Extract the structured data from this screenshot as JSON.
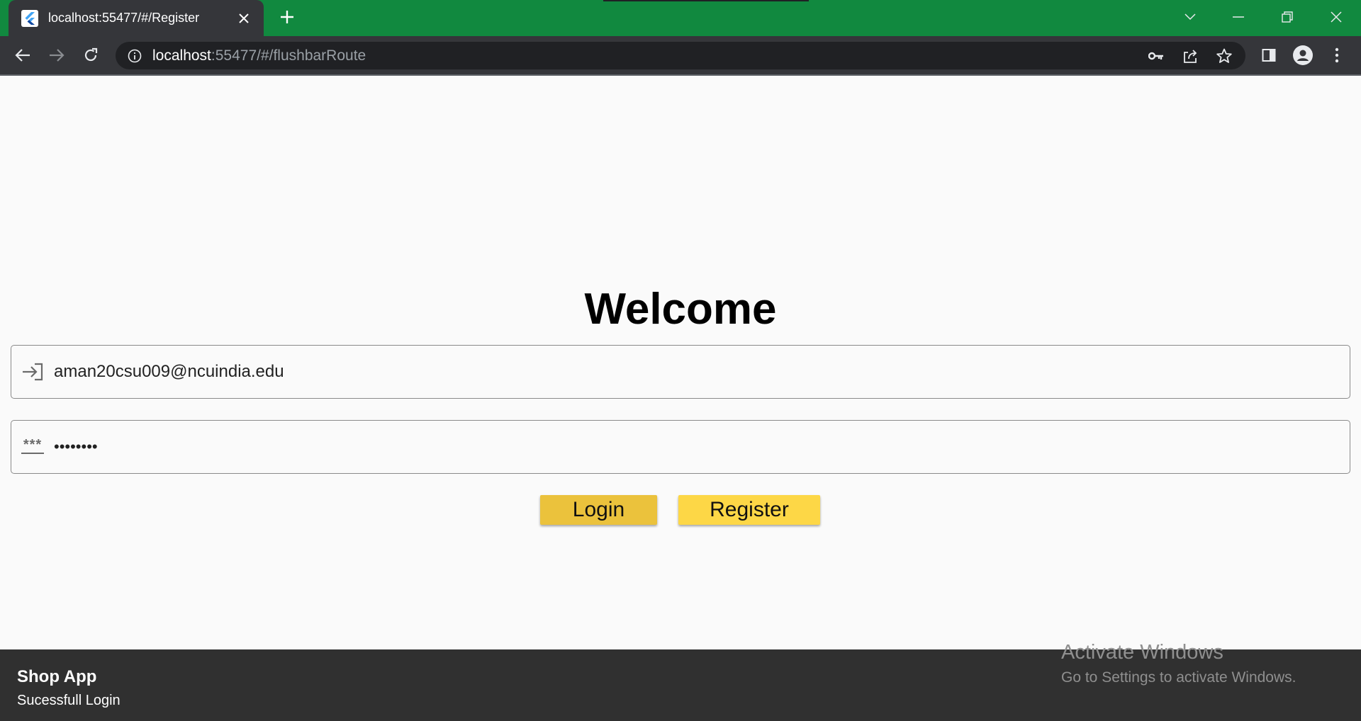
{
  "browser": {
    "tab": {
      "title": "localhost:55477/#/Register"
    },
    "omnibox": {
      "host": "localhost",
      "path": ":55477/#/flushbarRoute"
    }
  },
  "page": {
    "heading": "Welcome",
    "email_field": {
      "value": "aman20csu009@ncuindia.edu"
    },
    "password_field": {
      "value": "••••••••",
      "icon_glyph": "***"
    },
    "buttons": {
      "login": "Login",
      "register": "Register"
    }
  },
  "snackbar": {
    "title": "Shop App",
    "message": "Sucessfull Login"
  },
  "watermark": {
    "title": "Activate Windows",
    "subtitle": "Go to Settings to activate Windows."
  },
  "colors": {
    "tabstrip": "#11893f",
    "toolbar": "#35363a",
    "omnibox": "#202124",
    "login_button": "#ebc23c",
    "register_button": "#fdd746",
    "snackbar": "#303030"
  },
  "icons": {
    "tab_favicon": "flutter-logo-icon",
    "tab_close": "close-icon",
    "new_tab": "plus-icon",
    "window": [
      "chevron-down-icon",
      "minimize-icon",
      "restore-icon",
      "close-icon"
    ],
    "nav": [
      "back-arrow-icon",
      "forward-arrow-icon",
      "reload-icon"
    ],
    "omnibox": [
      "info-icon",
      "key-icon",
      "share-icon",
      "star-icon"
    ],
    "toolbar_right": [
      "side-panel-icon",
      "profile-icon",
      "kebab-menu-icon"
    ],
    "email_prefix": "login-icon",
    "password_prefix": "password-icon"
  }
}
